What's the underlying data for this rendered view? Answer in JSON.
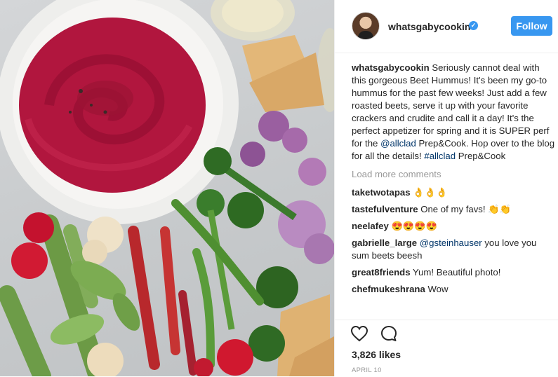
{
  "post": {
    "image_alt": "Beet hummus bowl with pita and vegetables",
    "author": "whatsgabycookin",
    "verified": true,
    "follow_label": "Follow",
    "caption": {
      "username": "whatsgabycookin",
      "text_part1": " Seriously cannot deal with this gorgeous Beet Hummus! It's been my go-to hummus for the past few weeks! Just add a few roasted beets, serve it up with your favorite crackers and crudite and call it a day! It's the perfect appetizer for spring and it is SUPER perf for the ",
      "mention": "@allclad",
      "text_part2": " Prep&Cook. Hop over to the blog for all the details! ",
      "hashtag": "#allclad",
      "text_part3": " Prep&Cook"
    },
    "load_more_label": "Load more comments",
    "comments": [
      {
        "username": "taketwotapas",
        "text": "",
        "emoji": "👌👌👌"
      },
      {
        "username": "tastefulventure",
        "text": " One of my favs! ",
        "emoji": "👏👏"
      },
      {
        "username": "neelafey",
        "text": " ",
        "emoji": "😍😍😍😍"
      },
      {
        "username": "gabrielle_large",
        "text": " ",
        "mention": "@gsteinhauser",
        "text2": " you love you sum beets beesh"
      },
      {
        "username": "great8friends",
        "text": " Yum! Beautiful photo!"
      },
      {
        "username": "chefmukeshrana",
        "text": " Wow"
      }
    ],
    "likes": "3,826 likes",
    "date": "APRIL 10",
    "icons": {
      "like": "heart-icon",
      "comment": "comment-icon",
      "verified": "verified-badge-icon"
    },
    "colors": {
      "accent": "#3897f0",
      "text": "#262626",
      "muted": "#999999",
      "link": "#003569"
    }
  }
}
